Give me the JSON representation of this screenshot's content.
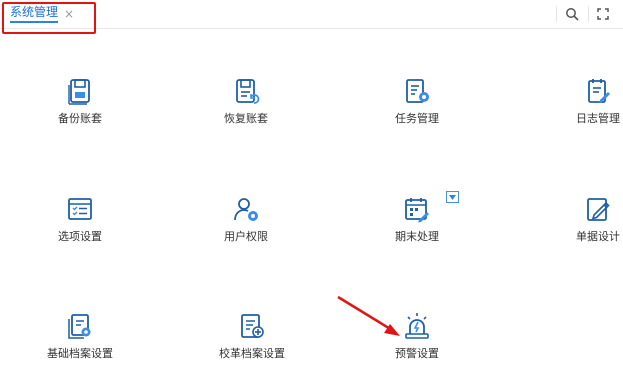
{
  "tab": {
    "title": "系统管理",
    "close_glyph": "×"
  },
  "toolbar": {
    "search_icon": "search-icon",
    "fullscreen_icon": "fullscreen-icon"
  },
  "tiles": [
    {
      "label": "备份账套",
      "icon": "backup-disk-icon"
    },
    {
      "label": "恢复账套",
      "icon": "restore-disk-icon"
    },
    {
      "label": "任务管理",
      "icon": "task-settings-icon"
    },
    {
      "label": "日志管理",
      "icon": "log-edit-icon"
    },
    {
      "label": "选项设置",
      "icon": "options-list-icon"
    },
    {
      "label": "用户权限",
      "icon": "user-settings-icon"
    },
    {
      "label": "期末处理",
      "icon": "calendar-settings-icon"
    },
    {
      "label": "单据设计",
      "icon": "document-edit-icon"
    },
    {
      "label": "基础档案设置",
      "icon": "archive-settings-icon"
    },
    {
      "label": "校革档案设置",
      "icon": "archive-add-icon"
    },
    {
      "label": "预警设置",
      "icon": "alarm-light-icon"
    }
  ],
  "colors": {
    "accent": "#2f7fe6",
    "icon_blue": "#1f5fa8",
    "highlight_red": "#e11414"
  }
}
